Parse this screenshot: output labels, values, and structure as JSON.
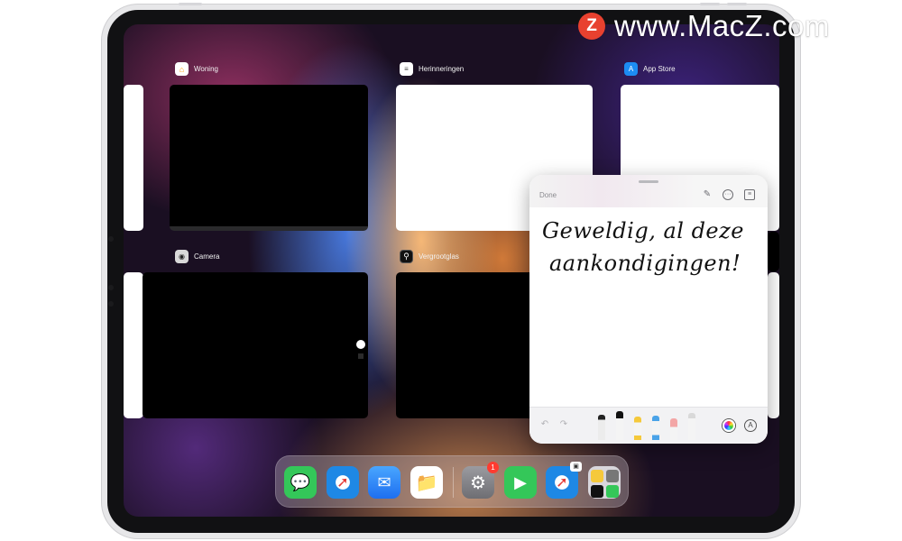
{
  "watermark": {
    "logo_letter": "Z",
    "text": "www.MacZ.com",
    "logo_color": "#e8412f"
  },
  "switcher": {
    "apps": [
      {
        "name": "Woning",
        "icon": "home-icon",
        "icon_color": "#ff9f0a",
        "card": "black"
      },
      {
        "name": "Herinneringen",
        "icon": "reminders-icon",
        "icon_color": "#ffffff",
        "card": "white"
      },
      {
        "name": "App Store",
        "icon": "app-store-icon",
        "icon_color": "#1c8cf3",
        "card": "white"
      },
      {
        "name": "Camera",
        "icon": "camera-icon",
        "icon_color": "#d9d9d9",
        "card": "black"
      },
      {
        "name": "Vergrootglas",
        "icon": "magnifier-icon",
        "icon_color": "#111111",
        "card": "black"
      }
    ]
  },
  "quick_note": {
    "done_label": "Done",
    "header_icons": [
      "compose-icon",
      "more-icon",
      "notes-list-icon"
    ],
    "handwriting_line1": "Geweldig, al deze",
    "handwriting_line2": "aankondigingen!",
    "toolbar": [
      "undo-icon",
      "redo-icon",
      "pen-tool",
      "marker-tool",
      "highlighter-tool",
      "pencil-tool",
      "eraser-tool",
      "ruler-tool",
      "color-picker-icon",
      "markup-icon"
    ],
    "markup_label": "A"
  },
  "dock": {
    "apps": [
      {
        "name": "Messages",
        "icon": "messages-icon",
        "color": "#34c759"
      },
      {
        "name": "Safari",
        "icon": "safari-icon",
        "color": "#1e88e5"
      },
      {
        "name": "Mail",
        "icon": "mail-icon",
        "color": "#2d7ff9"
      },
      {
        "name": "Files",
        "icon": "files-icon",
        "color": "#2b8cf7"
      },
      {
        "name": "Settings",
        "icon": "settings-icon",
        "color": "#8e8e93",
        "badge": "1"
      },
      {
        "name": "FaceTime",
        "icon": "facetime-icon",
        "color": "#34c759"
      },
      {
        "name": "Safari",
        "icon": "safari-icon",
        "color": "#1e88e5"
      },
      {
        "name": "App Library",
        "icon": "app-library-icon",
        "color": "#d8d6dc"
      }
    ]
  }
}
